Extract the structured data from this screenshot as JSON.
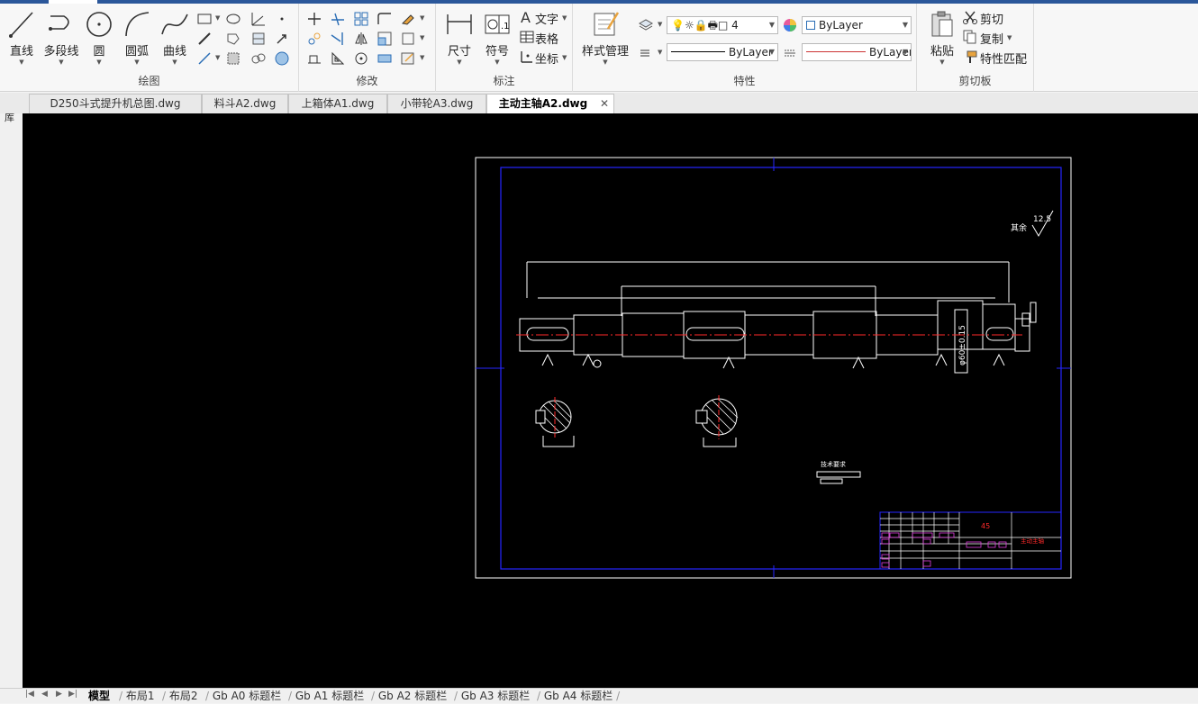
{
  "ribbon": {
    "draw": {
      "title": "绘图",
      "line": "直线",
      "polyline": "多段线",
      "circle": "圆",
      "arc": "圆弧",
      "curve": "曲线"
    },
    "modify": {
      "title": "修改"
    },
    "annotate": {
      "title": "标注",
      "dimension": "尺寸",
      "symbol": "符号",
      "text": "文字",
      "table": "表格",
      "coord": "坐标"
    },
    "properties": {
      "title": "特性",
      "style_manager": "样式管理",
      "layer_value": "4",
      "color": "ByLayer",
      "linetype": "ByLayer",
      "lineweight": "ByLayer"
    },
    "clipboard": {
      "title": "剪切板",
      "paste": "粘贴",
      "cut": "剪切",
      "copy": "复制",
      "match": "特性匹配"
    }
  },
  "left_strip": {
    "label": "图库"
  },
  "doc_tabs": [
    {
      "label": "D250斗式提升机总图.dwg",
      "active": false
    },
    {
      "label": "料斗A2.dwg",
      "active": false
    },
    {
      "label": "上箱体A1.dwg",
      "active": false
    },
    {
      "label": "小带轮A3.dwg",
      "active": false
    },
    {
      "label": "主动主轴A2.dwg",
      "active": true
    }
  ],
  "drawing": {
    "roughness": "12.5",
    "rough_label": "其余",
    "tech_req": "技术要求",
    "material": "45",
    "part_name": "主动主轴",
    "dim_text": "φ60±0.15"
  },
  "layout_tabs": [
    {
      "label": "模型",
      "active": true
    },
    {
      "label": "布局1",
      "active": false
    },
    {
      "label": "布局2",
      "active": false
    },
    {
      "label": "Gb A0 标题栏",
      "active": false
    },
    {
      "label": "Gb A1 标题栏",
      "active": false
    },
    {
      "label": "Gb A2 标题栏",
      "active": false
    },
    {
      "label": "Gb A3 标题栏",
      "active": false
    },
    {
      "label": "Gb A4 标题栏",
      "active": false
    }
  ]
}
